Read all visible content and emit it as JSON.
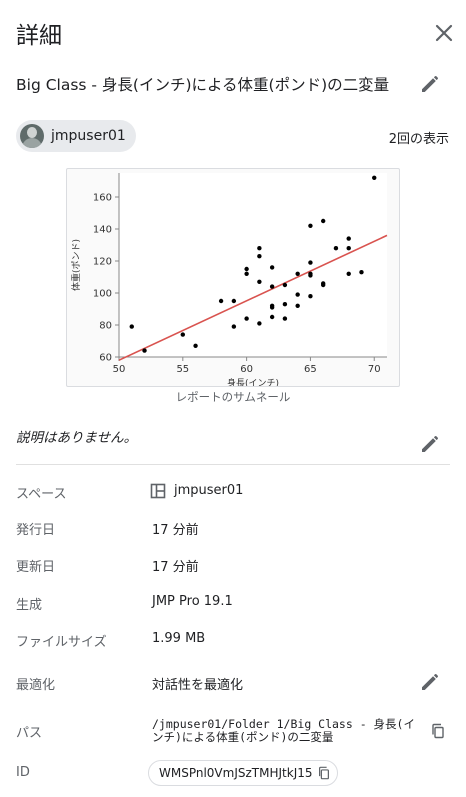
{
  "header": {
    "title": "詳細"
  },
  "report": {
    "title": "Big Class - 身長(インチ)による体重(ポンド)の二変量"
  },
  "owner": {
    "name": "jmpuser01"
  },
  "views": {
    "label": "2回の表示"
  },
  "thumbnail": {
    "caption": "レポートのサムネール"
  },
  "description": {
    "text": "説明はありません。"
  },
  "details": {
    "space": {
      "label": "スペース",
      "value": "jmpuser01"
    },
    "published": {
      "label": "発行日",
      "value": "17 分前"
    },
    "updated": {
      "label": "更新日",
      "value": "17 分前"
    },
    "created_by": {
      "label": "生成",
      "value": "JMP Pro 19.1"
    },
    "file_size": {
      "label": "ファイルサイズ",
      "value": "1.99 MB"
    },
    "optimization": {
      "label": "最適化",
      "value": "対話性を最適化"
    },
    "path": {
      "label": "パス",
      "value": "/jmpuser01/Folder 1/Big Class - 身長(インチ)による体重(ポンド)の二変量"
    },
    "id": {
      "label": "ID",
      "value": "WMSPnl0VmJSzTMHJtkJ15"
    }
  },
  "icons": {
    "close": "close-icon",
    "edit": "pencil-icon",
    "copy": "copy-icon",
    "space": "space-layout-icon"
  },
  "colors": {
    "fit_line": "#d9534f",
    "points": "#000000",
    "chip_bg": "#e8eaed"
  },
  "chart_data": {
    "type": "scatter",
    "xlabel": "身長(インチ)",
    "ylabel": "体重(ポンド)",
    "xlim": [
      50,
      71
    ],
    "ylim": [
      60,
      175
    ],
    "xticks": [
      50,
      55,
      60,
      65,
      70
    ],
    "yticks": [
      60,
      80,
      100,
      120,
      140,
      160
    ],
    "points": [
      [
        51,
        79
      ],
      [
        52,
        64
      ],
      [
        55,
        74
      ],
      [
        56,
        67
      ],
      [
        58,
        95
      ],
      [
        59,
        79
      ],
      [
        59,
        95
      ],
      [
        60,
        84
      ],
      [
        60,
        112
      ],
      [
        60,
        115
      ],
      [
        61,
        81
      ],
      [
        61,
        107
      ],
      [
        61,
        123
      ],
      [
        61,
        128
      ],
      [
        62,
        85
      ],
      [
        62,
        91
      ],
      [
        62,
        92
      ],
      [
        62,
        104
      ],
      [
        62,
        116
      ],
      [
        63,
        84
      ],
      [
        63,
        93
      ],
      [
        63,
        105
      ],
      [
        64,
        92
      ],
      [
        64,
        99
      ],
      [
        64,
        112
      ],
      [
        65,
        98
      ],
      [
        65,
        111
      ],
      [
        65,
        112
      ],
      [
        65,
        119
      ],
      [
        65,
        142
      ],
      [
        66,
        105
      ],
      [
        66,
        106
      ],
      [
        66,
        145
      ],
      [
        67,
        128
      ],
      [
        68,
        112
      ],
      [
        68,
        128
      ],
      [
        68,
        134
      ],
      [
        69,
        113
      ],
      [
        70,
        172
      ]
    ],
    "fit_line": {
      "x": [
        50,
        71
      ],
      "y": [
        58,
        136
      ]
    }
  }
}
